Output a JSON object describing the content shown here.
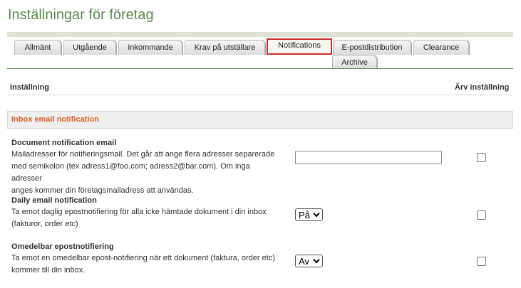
{
  "page": {
    "title": "Inställningar för företag"
  },
  "tabs": [
    {
      "label": "Allmänt",
      "active": false
    },
    {
      "label": "Utgående",
      "active": false
    },
    {
      "label": "Inkommande",
      "active": false
    },
    {
      "label": "Krav på utställare",
      "active": false
    },
    {
      "label": "Notifications",
      "active": true
    },
    {
      "label": "E-postdistribution",
      "active": false
    },
    {
      "label": "Clearance",
      "active": false
    },
    {
      "label": "Archive",
      "active": false
    }
  ],
  "table": {
    "col_setting": "Inställning",
    "col_inherit": "Ärv inställning"
  },
  "section": {
    "title": "Inbox email notification"
  },
  "settings": [
    {
      "title": "Document notification email",
      "description_lines": [
        "Mailadresser för notifieringsmail. Det går att ange flera adresser separerade",
        "med semikolon (tex adress1@foo.com; adress2@bar.com). Om inga adresser",
        "anges kommer din företagsmailadress att användas."
      ],
      "input_value": "",
      "inherit_checked": false
    },
    {
      "title": "Daily email notification",
      "description_lines": [
        "Ta emot daglig epostnotifiering för alla icke hämtade dokument i din inbox",
        "(fakturor, order etc)"
      ],
      "select_value": "På",
      "inherit_checked": false
    },
    {
      "title": "Omedelbar epostnotifiering",
      "description_lines": [
        "Ta emot en omedelbar epost-notifiering när ett dokument (faktura, order etc)",
        "kommer till din inbox."
      ],
      "select_value": "Av",
      "inherit_checked": false
    }
  ],
  "colors": {
    "title": "#5a8a4e",
    "section_title": "#d4602a",
    "active_tab_border": "#cc2a2a"
  },
  "icons": {
    "select_arrow": "chevron-down-icon"
  }
}
